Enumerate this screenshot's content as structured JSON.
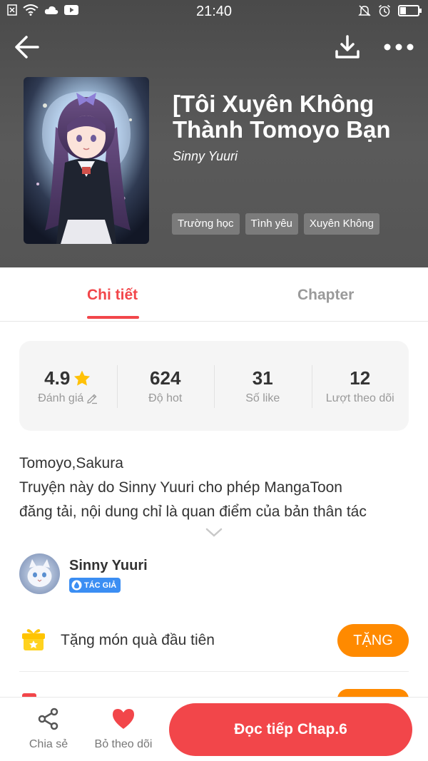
{
  "status_bar": {
    "time": "21:40"
  },
  "book": {
    "title": "[Tôi Xuyên Không Thành Tomoyo Bạn",
    "author": "Sinny Yuuri",
    "tags": [
      "Trường học",
      "Tình yêu",
      "Xuyên Không"
    ]
  },
  "tabs": {
    "detail": "Chi tiết",
    "chapter": "Chapter",
    "active": "detail"
  },
  "stats": {
    "rating_value": "4.9",
    "rating_label": "Đánh giá",
    "hot_value": "624",
    "hot_label": "Độ hot",
    "likes_value": "31",
    "likes_label": "Số like",
    "follows_value": "12",
    "follows_label": "Lượt theo dõi"
  },
  "description": {
    "line1": "Tomoyo,Sakura",
    "line2": "Truyện này do Sinny Yuuri cho phép MangaToon",
    "line3": "đăng tải, nội dung chỉ là quan điểm của bản thân tác"
  },
  "author_section": {
    "name": "Sinny Yuuri",
    "badge": "TÁC GIẢ"
  },
  "gift": {
    "text": "Tặng món quà đầu tiên",
    "button": "TẶNG"
  },
  "bottom_bar": {
    "share_label": "Chia sẻ",
    "unfollow_label": "Bỏ theo dõi",
    "read_button": "Đọc tiếp Chap.6"
  },
  "colors": {
    "accent": "#f2464a",
    "gift_button": "#ff8a00",
    "badge": "#3b8ef3",
    "star": "#ffc107"
  }
}
